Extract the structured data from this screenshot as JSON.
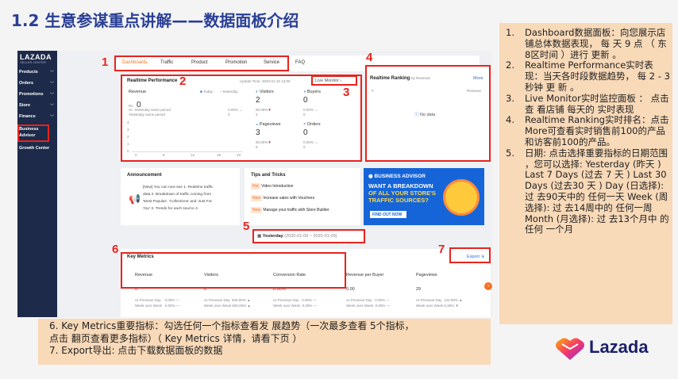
{
  "slide": {
    "title": "1.2  生意参谋重点讲解——数据面板介绍"
  },
  "sidebar": {
    "logo": "LAZADA",
    "logo_sub": "SELLER CENTER",
    "items": [
      {
        "label": "Products",
        "chev": "﹀"
      },
      {
        "label": "Orders",
        "chev": "﹀"
      },
      {
        "label": "Promotions",
        "chev": "﹀"
      },
      {
        "label": "Store",
        "chev": "﹀"
      },
      {
        "label": "Finance",
        "chev": "﹀"
      },
      {
        "label": "Business",
        "chev": ""
      },
      {
        "label": "Advisor",
        "chev": ""
      },
      {
        "label": "Growth Center",
        "chev": ""
      }
    ]
  },
  "tabs": [
    "Dashboard",
    "Traffic",
    "Product",
    "Promotion",
    "Service",
    "FAQ"
  ],
  "tab_new_badge": "●",
  "realtime": {
    "title": "Realtime Performance",
    "update_time": "Update Time: 2020-01-10 13:00",
    "live_monitor": "Live Monitor",
    "live_chev": "›",
    "revenue_label": "Revenue",
    "revenue_value": "0",
    "currency": "Rs",
    "legend_today": "Today",
    "legend_yesterday": "Yesterday",
    "vs_label_1": "vs. Yesterday same period",
    "vs_label_2": "Yesterday same period",
    "revenue_pct": "0.00% ↔",
    "revenue_prev": "0",
    "visitors_label": "Visitors",
    "visitors_value": "2",
    "visitors_pct": "50.00%",
    "visitors_prev": "4",
    "buyers_label": "Buyers",
    "buyers_value": "0",
    "buyers_pct": "0.00% ↔",
    "buyers_prev": "0",
    "pageviews_label": "Pageviews",
    "pageviews_value": "3",
    "pageviews_pct": "50.00%",
    "pageviews_prev": "6",
    "orders_label": "Orders",
    "orders_value": "0",
    "orders_pct": "0.00% ↔",
    "orders_prev": "0",
    "y_ticks": [
      "4",
      "3",
      "2",
      "1",
      "0"
    ],
    "x_ticks": [
      "0",
      "6",
      "12",
      "18",
      "23"
    ]
  },
  "ranking": {
    "title": "Realtime Ranking",
    "by": "by Revenue",
    "more": "More",
    "col_hash": "#",
    "col_revenue": "Revenue",
    "no_data": "No data"
  },
  "announcement": {
    "title": "Announcement",
    "text_lines": [
      "[New] You can now see 1. Realtime traffic",
      "data 2. Breakdown of traffic coming from",
      "'Most Popular', 'Collections' and 'Just For",
      "You' 3. Trends for each source 4."
    ]
  },
  "tips": {
    "title": "Tips and Tricks",
    "items": [
      {
        "badge": "Hot",
        "text": "Video Introduction"
      },
      {
        "badge": "New",
        "text": "Increase sales with Vouchers"
      },
      {
        "badge": "New",
        "text": "Manage your traffic with Store Builder"
      }
    ]
  },
  "ad": {
    "brand": "BUSINESS ADVISOR",
    "line1": "WANT A BREAKDOWN",
    "line2": "OF ALL YOUR STORE'S",
    "line3": "TRAFFIC SOURCES?",
    "button": "FIND OUT NOW ›"
  },
  "date_picker": {
    "label": "Yesterday",
    "range": "(2020-01-09 ~ 2020-01-09)"
  },
  "key_metrics": {
    "title": "Key Metrics",
    "export": "Export",
    "cards": [
      {
        "label": "Revenue",
        "value": "0",
        "cmp1": "vs Previous Day",
        "cmp1_val": "0.00% —",
        "cmp2": "Week over Week",
        "cmp2_val": "0.00% —"
      },
      {
        "label": "Visitors",
        "value": "6",
        "cmp1": "vs Previous Day",
        "cmp1_val": "500.00% ▲",
        "cmp2": "Week over Week",
        "cmp2_val": "500.00% ▲"
      },
      {
        "label": "Conversion Rate",
        "value": "0.00%",
        "cmp1": "vs Previous Day",
        "cmp1_val": "0.00% —",
        "cmp2": "Week over Week",
        "cmp2_val": "0.00% —"
      },
      {
        "label": "Revenue per Buyer",
        "value": "0.00",
        "cmp1": "vs Previous Day",
        "cmp1_val": "0.00% —",
        "cmp2": "Week over Week",
        "cmp2_val": "0.00% —"
      },
      {
        "label": "Pageviews",
        "value": "29",
        "cmp1": "vs Previous Day",
        "cmp1_val": "122.08% ▲",
        "cmp2": "Week over Week",
        "cmp2_val": "9.38% ▼"
      }
    ]
  },
  "markers": [
    "1",
    "2",
    "3",
    "4",
    "5",
    "6",
    "7"
  ],
  "right_notes": [
    {
      "n": "1.",
      "text": "Dashboard数据面板：向您展示店铺总体数据表现， 每 天 9 点 （ 东 8区时间 ）进行 更新 。"
    },
    {
      "n": "2.",
      "text": "Realtime Performance实时表现：当天各时段数据趋势， 每 2 - 3秒钟 更 新 。"
    },
    {
      "n": "3.",
      "text": "Live Monitor实时监控面板 ： 点击查 看店铺 每天的 实时表现"
    },
    {
      "n": "4.",
      "text": "Realtime Ranking实时排名：点击More可查看实时销售前100的产品和访客前100的产品。"
    },
    {
      "n": "5.",
      "text": "日期: 点击选择重要指标的日期范围 ，您可以选择: Yesterday (昨天 ) Last 7 Days (过去 7 天 ) Last 30 Days (过去30 天 ) Day (日选择): 过 去90天中的 任何一天 Week (周选择): 过 去14周中的 任何一周 Month (月选择): 过 去13个月中 的任何 一个月"
    }
  ],
  "bottom_notes": [
    "6.  Key Metrics重要指标：勾选任何一个指标查看发 展趋势（一次最多查看 5个指标，",
    "     点击 翻页查看更多指标）（ Key Metrics 详情，请看下页 ）",
    "7.  Export导出: 点击下载数据面板的数据"
  ],
  "lazada": {
    "name": "Lazada"
  },
  "colors": {
    "title": "#2a3f95",
    "annotation_red": "#e8231c",
    "lazada_orange": "#f57224",
    "note_bg": "#f8d9b8",
    "sidebar_bg": "#1d2a49"
  }
}
